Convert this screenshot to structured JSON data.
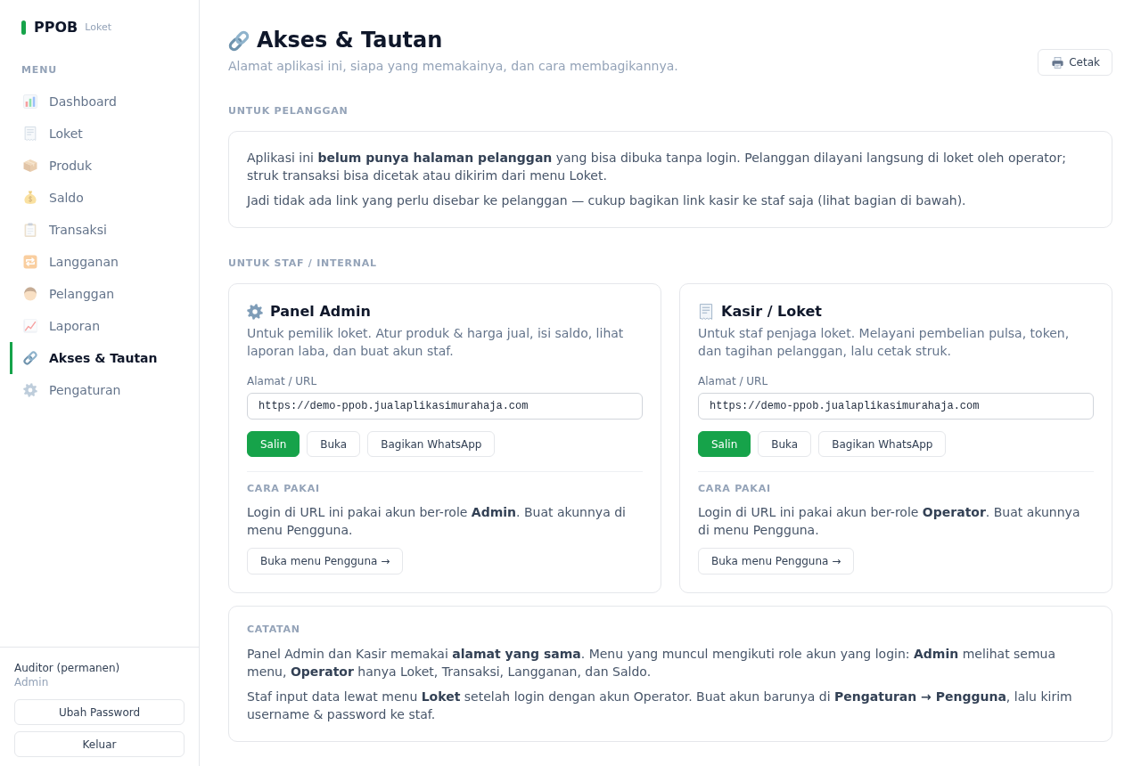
{
  "sidebar": {
    "brand": {
      "name": "PPOB",
      "tag": "Loket"
    },
    "menu_heading": "MENU",
    "items": [
      {
        "label": "Dashboard",
        "selected": false
      },
      {
        "label": "Loket",
        "selected": false
      },
      {
        "label": "Produk",
        "selected": false
      },
      {
        "label": "Saldo",
        "selected": false
      },
      {
        "label": "Transaksi",
        "selected": false
      },
      {
        "label": "Langganan",
        "selected": false
      },
      {
        "label": "Pelanggan",
        "selected": false
      },
      {
        "label": "Laporan",
        "selected": false
      },
      {
        "label": "Akses & Tautan",
        "selected": true
      },
      {
        "label": "Pengaturan",
        "selected": false
      }
    ],
    "user": {
      "name": "Auditor (permanen)",
      "role": "Admin"
    },
    "buttons": [
      "Ubah Password",
      "Keluar"
    ]
  },
  "header": {
    "title": "Akses & Tautan",
    "subtitle": "Alamat aplikasi ini, siapa yang memakainya, dan cara membagikannya.",
    "print_button": "Cetak"
  },
  "customer_section": {
    "heading": "UNTUK PELANGGAN",
    "paragraphs": [
      "Aplikasi ini **belum punya halaman pelanggan** yang bisa dibuka tanpa login. Pelanggan dilayani langsung di loket oleh operator; struk transaksi bisa dicetak atau dikirim dari menu Loket.",
      "Jadi tidak ada link yang perlu disebar ke pelanggan — cukup bagikan link kasir ke staf saja (lihat bagian di bawah)."
    ]
  },
  "staff_section": {
    "heading": "UNTUK STAF / INTERNAL",
    "cards": [
      {
        "title": "Panel Admin",
        "description": "Untuk pemilik loket. Atur produk & harga jual, isi saldo, lihat laporan laba, dan buat akun staf.",
        "url_label": "Alamat / URL",
        "url": "https://demo-ppob.jualaplikasimurahaja.com",
        "buttons": [
          {
            "label": "Salin",
            "kind": "primary"
          },
          {
            "label": "Buka",
            "kind": "secondary"
          },
          {
            "label": "Bagikan WhatsApp",
            "kind": "secondary"
          }
        ],
        "usage_heading": "CARA PAKAI",
        "usage_text": "Login di URL ini pakai akun ber-role **Admin**. Buat akunnya di menu Pengguna.",
        "link_button": "Buka menu Pengguna →"
      },
      {
        "title": "Kasir / Loket",
        "description": "Untuk staf penjaga loket. Melayani pembelian pulsa, token, dan tagihan pelanggan, lalu cetak struk.",
        "url_label": "Alamat / URL",
        "url": "https://demo-ppob.jualaplikasimurahaja.com",
        "buttons": [
          {
            "label": "Salin",
            "kind": "primary"
          },
          {
            "label": "Buka",
            "kind": "secondary"
          },
          {
            "label": "Bagikan WhatsApp",
            "kind": "secondary"
          }
        ],
        "usage_heading": "CARA PAKAI",
        "usage_text": "Login di URL ini pakai akun ber-role **Operator**. Buat akunnya di menu Pengguna.",
        "link_button": "Buka menu Pengguna →"
      }
    ]
  },
  "notes": {
    "heading": "CATATAN",
    "paragraphs": [
      "Panel Admin dan Kasir memakai **alamat yang sama**. Menu yang muncul mengikuti role akun yang login: **Admin** melihat semua menu, **Operator** hanya Loket, Transaksi, Langganan, dan Saldo.",
      "Staf input data lewat menu **Loket** setelah login dengan akun Operator. Buat akun barunya di **Pengaturan → Pengguna**, lalu kirim username & password ke staf."
    ]
  }
}
